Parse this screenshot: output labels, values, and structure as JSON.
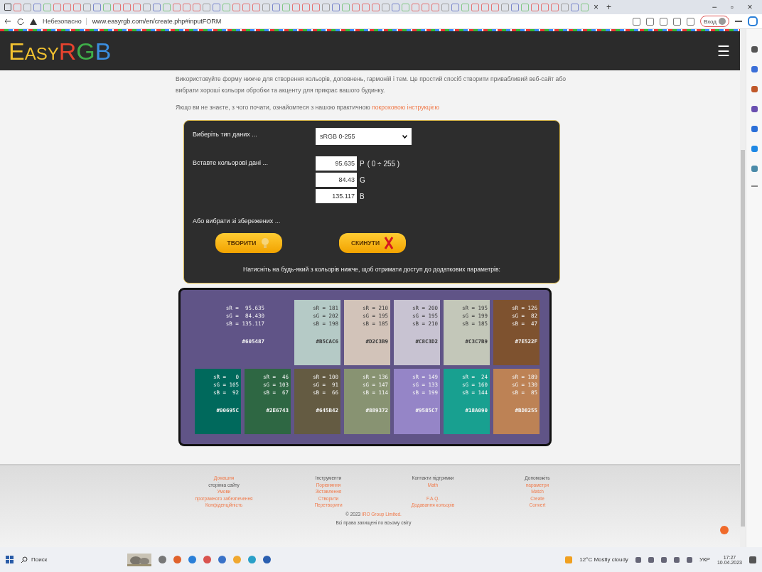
{
  "browser": {
    "new_tab": "+",
    "close_tab": "×",
    "window_controls": [
      "−",
      "▫",
      "×"
    ],
    "security": "Небезопасно",
    "url": "www.easyrgb.com/en/create.php#inputFORM",
    "profile": "Вход"
  },
  "header": {
    "logo": [
      {
        "text": "Easy",
        "color": "#f2c230"
      },
      {
        "text": "R",
        "color": "#e8432e"
      },
      {
        "text": "G",
        "color": "#3fae49"
      },
      {
        "text": "B",
        "color": "#3b8ee0"
      }
    ],
    "menu": "☰"
  },
  "intro": [
    "Використовуйте форму нижче для створення кольорів, доповнень, гармоній і тем. Це простий спосіб створити привабливий веб-сайт або вибрати хороші кольори обробки та акценту для прикрас вашого будинку."
  ],
  "hint": {
    "text": "Якщо ви не знаєте, з чого почати, ознайомтеся з нашою практичною",
    "link": "покроковою інструкцією"
  },
  "form": {
    "type_label": "Виберіть тип даних ...",
    "type_value": "sRGB 0-255",
    "data_label": "Вставте кольорові дані ...",
    "inputs": [
      {
        "value": "95.635",
        "unit": "P",
        "range": "( 0 ÷ 255 )"
      },
      {
        "value": "84.43",
        "unit": "G"
      },
      {
        "value": "135.117",
        "unit": "B"
      }
    ],
    "saved_label": "Або вибрати зі збережених ...",
    "buttons": [
      {
        "label": "ТВОРИТИ",
        "kind": "create"
      },
      {
        "label": "СКИНУТИ",
        "kind": "reset"
      }
    ],
    "note": "Натисніть на будь-який з кольорів нижче, щоб отримати доступ до додаткових параметрів:"
  },
  "swatches": [
    {
      "kind": "main",
      "color": "#605487",
      "lines": [
        "sR =  95.635",
        "sG =  84.430",
        "sB = 135.117"
      ],
      "hex": "#605487"
    },
    {
      "kind": "tile",
      "color": "#b5cac6",
      "lines": [
        "sR = 181",
        "sG = 202",
        "sB = 198"
      ],
      "hex": "#B5CAC6"
    },
    {
      "kind": "tile",
      "color": "#d2c3b9",
      "lines": [
        "sR = 210",
        "sG = 195",
        "sB = 185"
      ],
      "hex": "#D2C3B9"
    },
    {
      "kind": "tile",
      "color": "#c8c3d2",
      "lines": [
        "sR = 200",
        "sG = 195",
        "sB = 210"
      ],
      "hex": "#C8C3D2"
    },
    {
      "kind": "tile",
      "color": "#c3c7b9",
      "lines": [
        "sR = 195",
        "sG = 199",
        "sB = 185"
      ],
      "hex": "#C3C7B9"
    },
    {
      "kind": "tile",
      "color": "#7e522f",
      "lines": [
        "sR = 126",
        "sG =  82",
        "sB =  47"
      ],
      "hex": "#7E522F"
    },
    {
      "kind": "tile",
      "color": "#00695c",
      "lines": [
        "sR =   0",
        "sG = 105",
        "sB =  92"
      ],
      "hex": "#00695C"
    },
    {
      "kind": "tile",
      "color": "#2e6743",
      "lines": [
        "sR =  46",
        "sG = 103",
        "sB =  67"
      ],
      "hex": "#2E6743"
    },
    {
      "kind": "tile",
      "color": "#645b42",
      "lines": [
        "sR = 100",
        "sG =  91",
        "sB =  66"
      ],
      "hex": "#645B42"
    },
    {
      "kind": "tile",
      "color": "#889372",
      "lines": [
        "sR = 136",
        "sG = 147",
        "sB = 114"
      ],
      "hex": "#889372"
    },
    {
      "kind": "tile",
      "color": "#9585c7",
      "lines": [
        "sR = 149",
        "sG = 133",
        "sB = 199"
      ],
      "hex": "#9585C7"
    },
    {
      "kind": "tile",
      "color": "#18a090",
      "lines": [
        "sR =  24",
        "sG = 160",
        "sB = 144"
      ],
      "hex": "#18A090"
    },
    {
      "kind": "tile",
      "color": "#bd8255",
      "lines": [
        "sR = 189",
        "sG = 130",
        "sB =  85"
      ],
      "hex": "#BD8255"
    }
  ],
  "footer": {
    "columns": [
      [
        {
          "kind": "link",
          "text": "Домашня"
        },
        {
          "kind": "label",
          "text": "сторінка сайту"
        },
        {
          "kind": "link",
          "text": "Умови"
        },
        {
          "kind": "link",
          "text": "програмного забезпечення"
        },
        {
          "kind": "link",
          "text": "Конфіденційність"
        }
      ],
      [
        {
          "kind": "label",
          "text": "Інструменти"
        },
        {
          "kind": "link",
          "text": "Порівняння"
        },
        {
          "kind": "link",
          "text": "Зіставлення"
        },
        {
          "kind": "link",
          "text": "Створити"
        },
        {
          "kind": "link",
          "text": "Перетворити"
        }
      ],
      [
        {
          "kind": "label",
          "text": "Контакти підтримки"
        },
        {
          "kind": "link",
          "text": "Math"
        },
        {
          "kind": "gap"
        },
        {
          "kind": "link",
          "text": "F.A.Q."
        },
        {
          "kind": "link",
          "text": "Додавання кольорів"
        }
      ],
      [
        {
          "kind": "label",
          "text": "Допоможіть"
        },
        {
          "kind": "link",
          "text": "параметри"
        },
        {
          "kind": "link",
          "text": "Match"
        },
        {
          "kind": "link",
          "text": "Create"
        },
        {
          "kind": "link",
          "text": "Convert"
        }
      ]
    ],
    "copyright": "© 2023",
    "company": "IRO Group Limited.",
    "rights": "Всі права захищені по всьому світу"
  },
  "taskbar": {
    "search": "Поиск",
    "weather": "12°C  Mostly cloudy",
    "language": "УКР",
    "time": "17:27",
    "date": "10.04.2023"
  }
}
